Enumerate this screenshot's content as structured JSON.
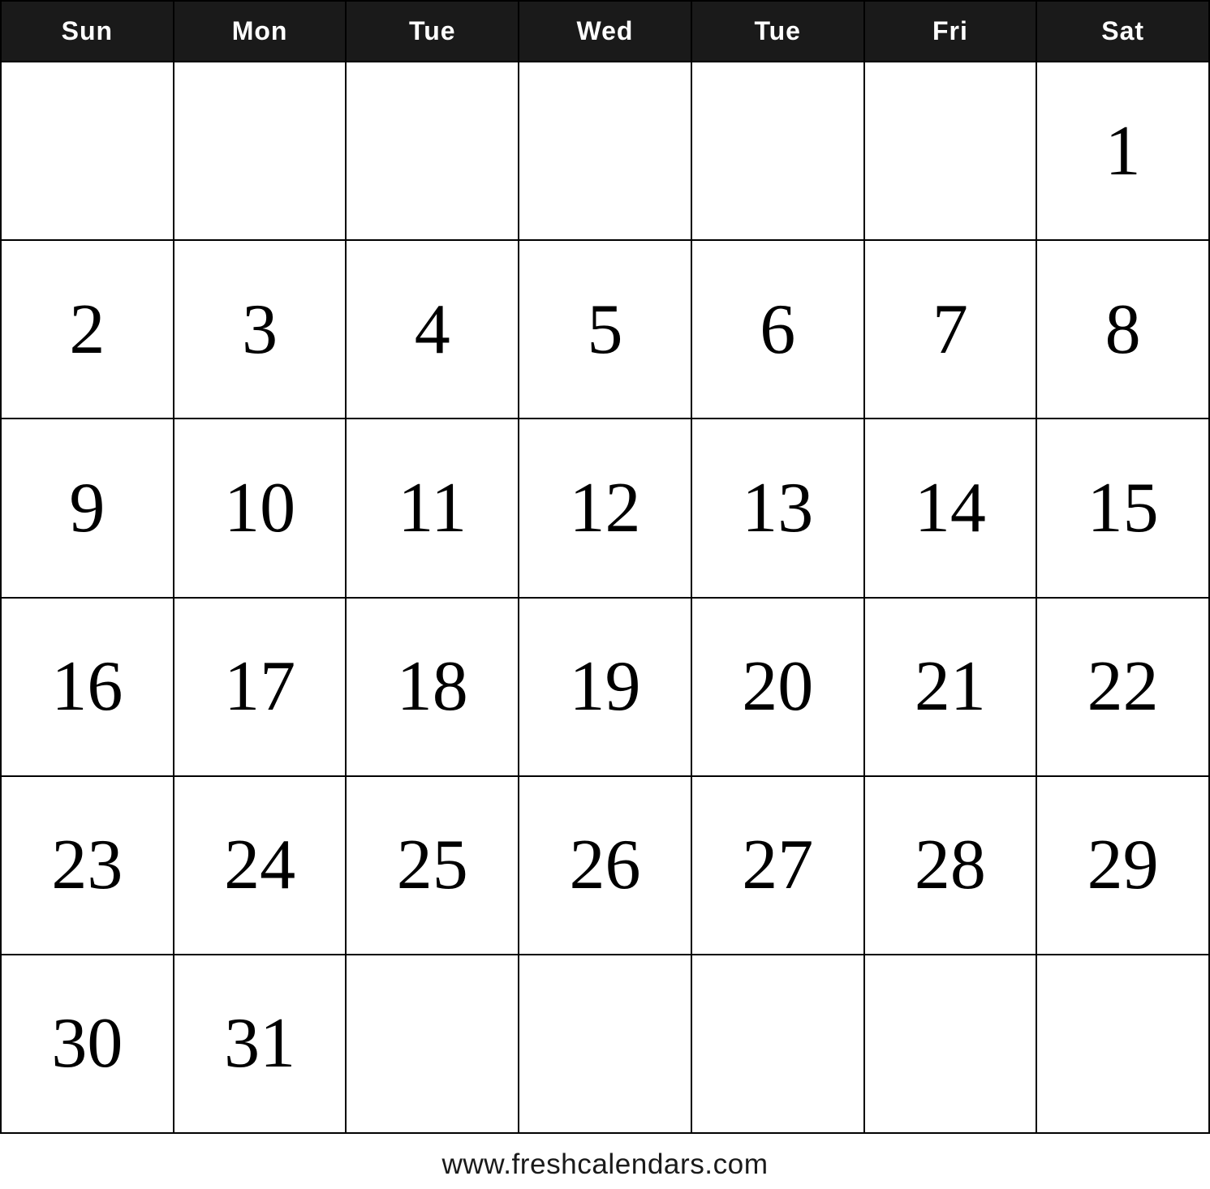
{
  "calendar": {
    "headers": [
      "Sun",
      "Mon",
      "Tue",
      "Wed",
      "Tue",
      "Fri",
      "Sat"
    ],
    "weeks": [
      [
        null,
        null,
        null,
        null,
        null,
        null,
        "1"
      ],
      [
        "2",
        "3",
        "4",
        "5",
        "6",
        "7",
        "8"
      ],
      [
        "9",
        "10",
        "11",
        "12",
        "13",
        "14",
        "15"
      ],
      [
        "16",
        "17",
        "18",
        "19",
        "20",
        "21",
        "22"
      ],
      [
        "23",
        "24",
        "25",
        "26",
        "27",
        "28",
        "29"
      ],
      [
        "30",
        "31",
        null,
        null,
        null,
        null,
        null
      ]
    ],
    "footer": "www.freshcalendars.com"
  }
}
